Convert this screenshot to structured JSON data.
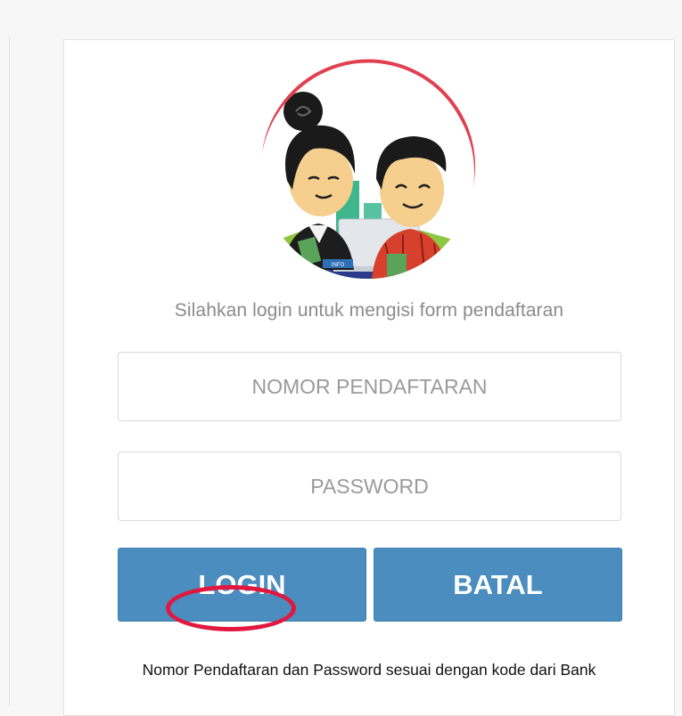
{
  "login": {
    "subtitle": "Silahkan login untuk mengisi form pendaftaran",
    "nomor_placeholder": "NOMOR PENDAFTARAN",
    "password_placeholder": "PASSWORD",
    "login_label": "LOGIN",
    "batal_label": "BATAL",
    "footnote": "Nomor Pendaftaran dan Password sesuai dengan kode dari Bank"
  },
  "colors": {
    "button": "#4a8dbe",
    "highlight": "#e2173f",
    "arc": "#e04050"
  },
  "illustration": {
    "icon": "two-cartoon-people-at-desk",
    "desk_sign": "INFO"
  }
}
